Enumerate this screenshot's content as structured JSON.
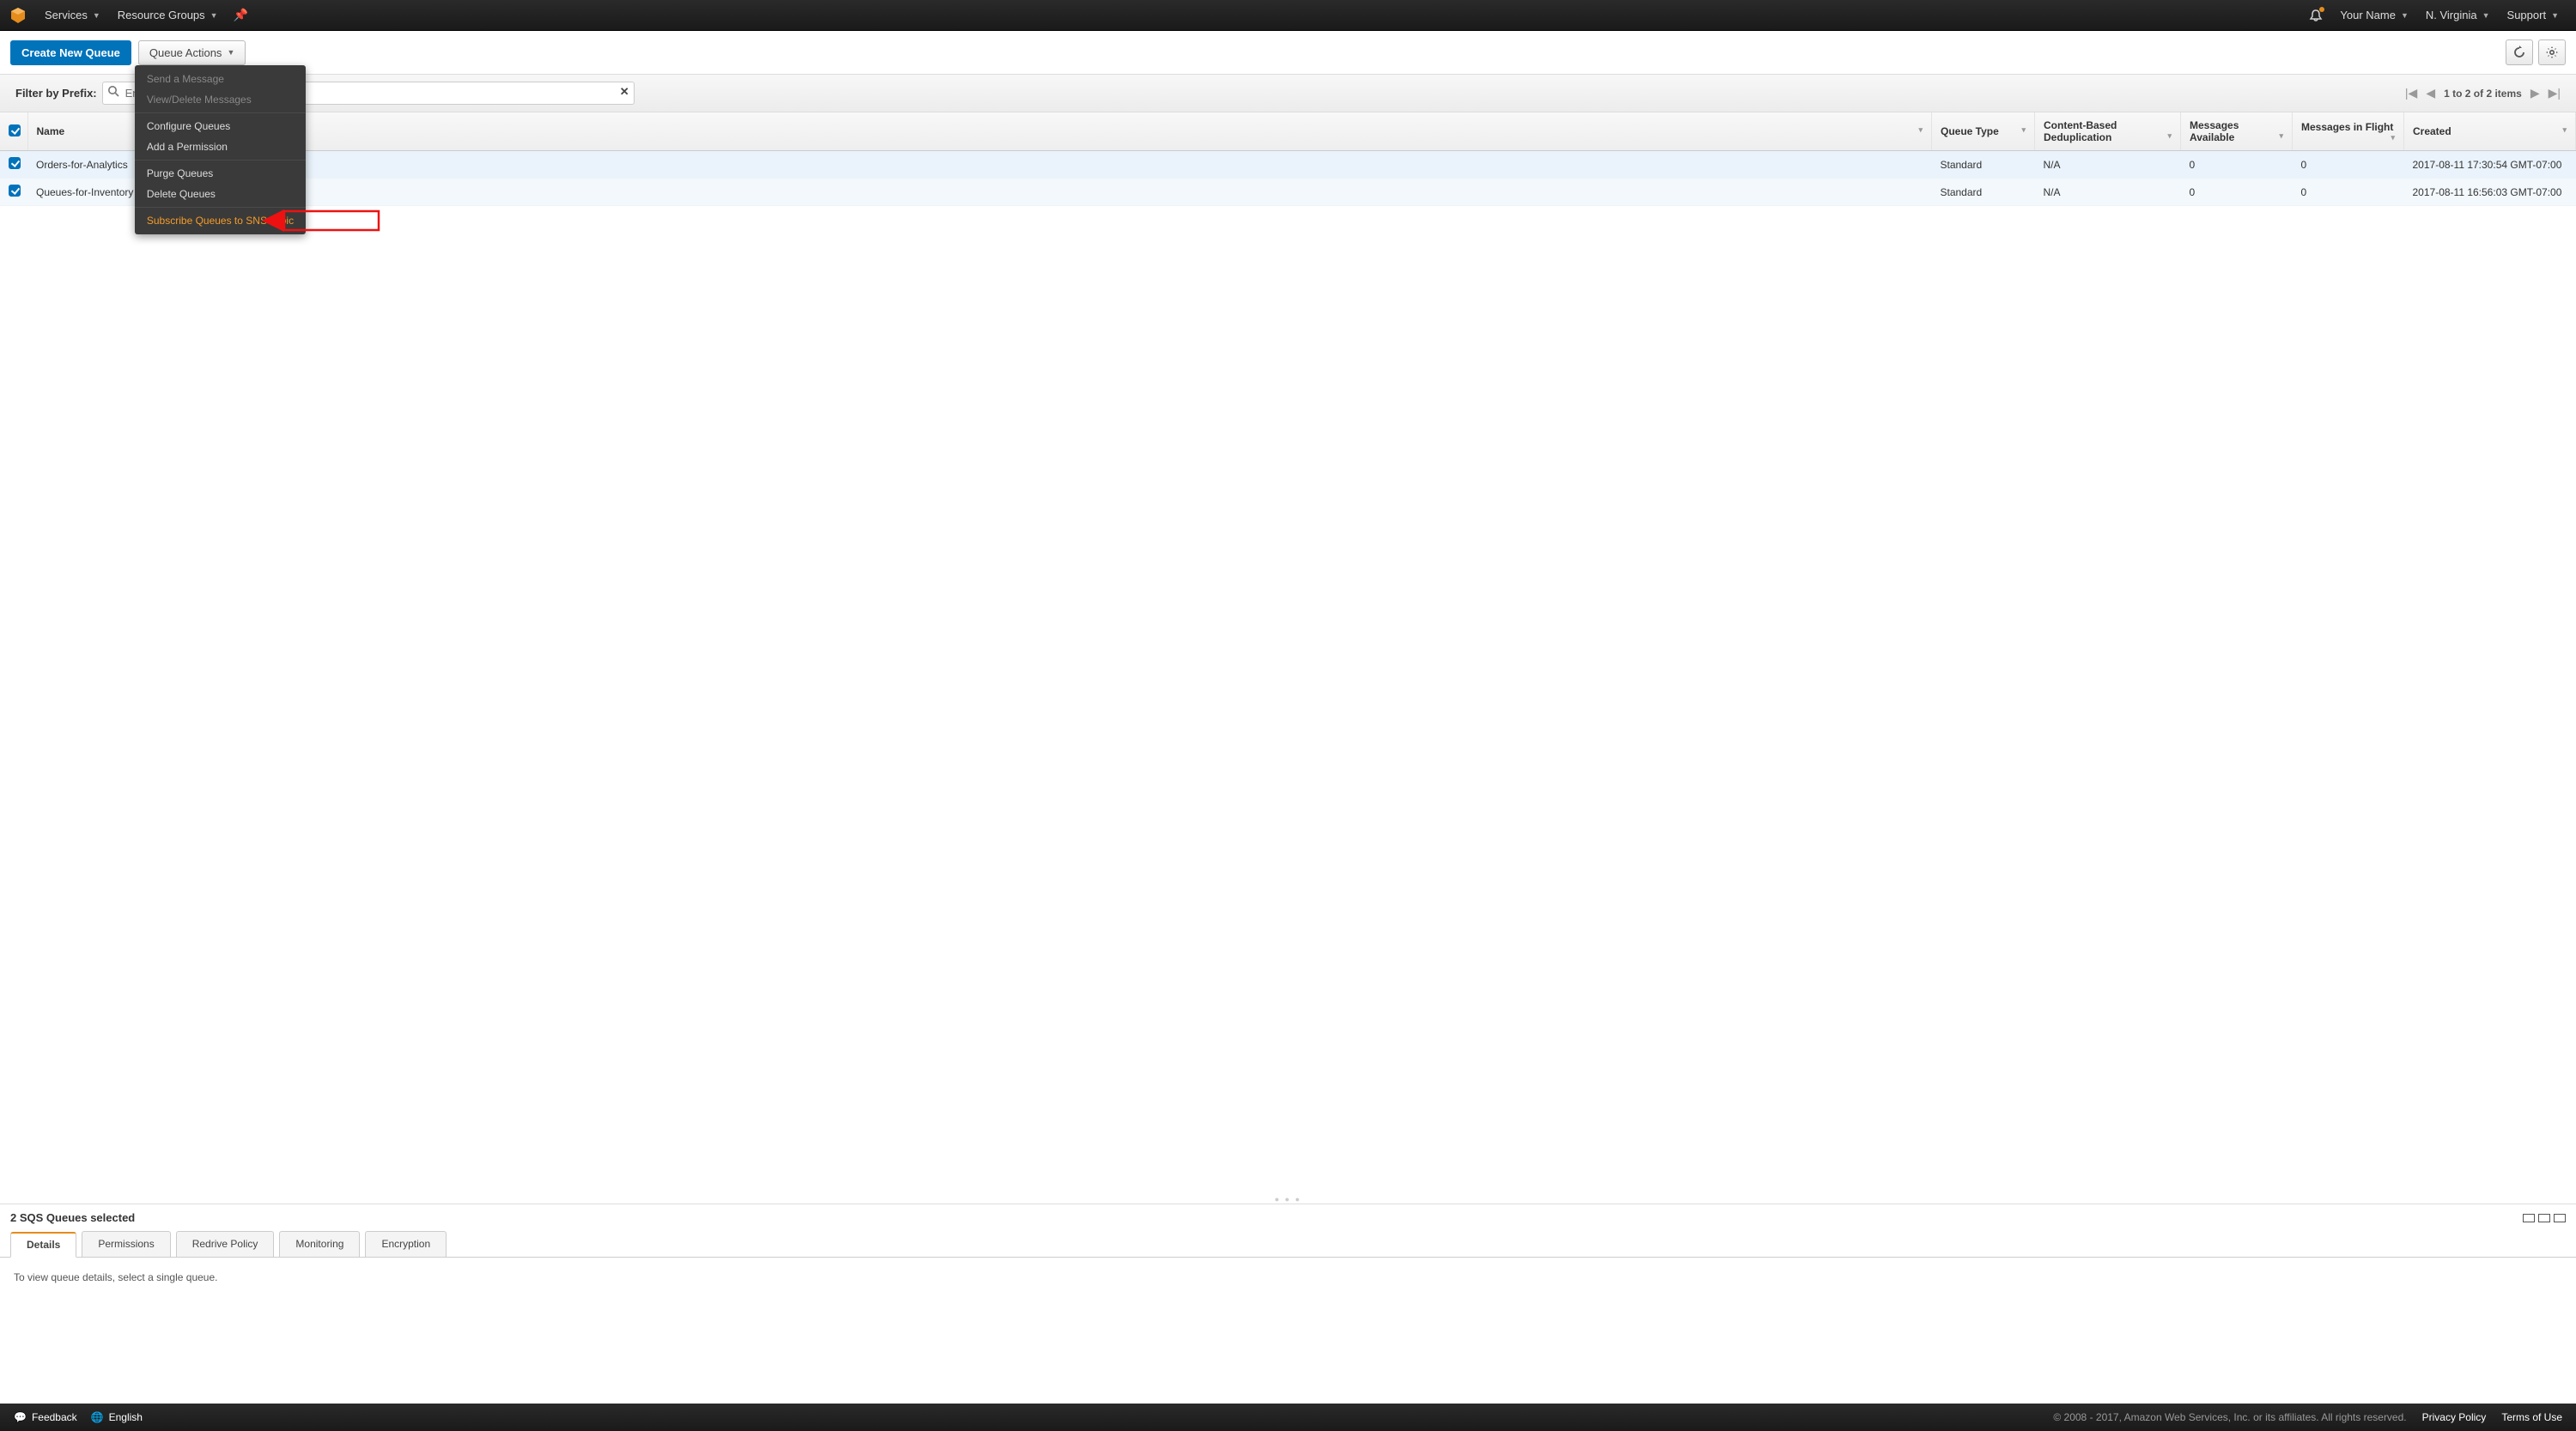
{
  "topnav": {
    "services": "Services",
    "resource_groups": "Resource Groups",
    "user": "Your Name",
    "region": "N. Virginia",
    "support": "Support"
  },
  "toolbar": {
    "create": "Create New Queue",
    "queue_actions": "Queue Actions"
  },
  "dropdown": {
    "send_msg": "Send a Message",
    "view_delete": "View/Delete Messages",
    "configure": "Configure Queues",
    "add_perm": "Add a Permission",
    "purge": "Purge Queues",
    "delete": "Delete Queues",
    "subscribe": "Subscribe Queues to SNS Topic"
  },
  "filter": {
    "label": "Filter by Prefix:",
    "placeholder": "Enter Text",
    "pager": "1 to 2 of 2 items"
  },
  "columns": {
    "name": "Name",
    "type": "Queue Type",
    "dedup": "Content-Based Deduplication",
    "avail": "Messages Available",
    "flight": "Messages in Flight",
    "created": "Created"
  },
  "rows": [
    {
      "name": "Orders-for-Analytics",
      "type": "Standard",
      "dedup": "N/A",
      "avail": "0",
      "flight": "0",
      "created": "2017-08-11 17:30:54 GMT-07:00"
    },
    {
      "name": "Queues-for-Inventory",
      "type": "Standard",
      "dedup": "N/A",
      "avail": "0",
      "flight": "0",
      "created": "2017-08-11 16:56:03 GMT-07:00"
    }
  ],
  "detail": {
    "selected": "2 SQS Queues selected",
    "tabs": {
      "details": "Details",
      "permissions": "Permissions",
      "redrive": "Redrive Policy",
      "monitoring": "Monitoring",
      "encryption": "Encryption"
    },
    "body": "To view queue details, select a single queue."
  },
  "footer": {
    "feedback": "Feedback",
    "language": "English",
    "copyright": "© 2008 - 2017, Amazon Web Services, Inc. or its affiliates. All rights reserved.",
    "privacy": "Privacy Policy",
    "terms": "Terms of Use"
  }
}
